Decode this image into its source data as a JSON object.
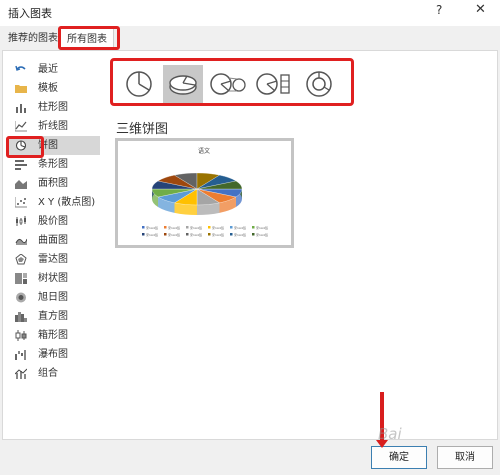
{
  "dialog": {
    "title": "插入图表",
    "help": "?",
    "close": "✕"
  },
  "tabs": [
    {
      "label": "推荐的图表"
    },
    {
      "label": "所有图表"
    }
  ],
  "sidebar": {
    "items": [
      {
        "label": "最近",
        "icon": "undo-arrow-icon"
      },
      {
        "label": "模板",
        "icon": "folder-icon"
      },
      {
        "label": "柱形图",
        "icon": "column-chart-icon"
      },
      {
        "label": "折线图",
        "icon": "line-chart-icon"
      },
      {
        "label": "饼图",
        "icon": "pie-chart-icon",
        "selected": true
      },
      {
        "label": "条形图",
        "icon": "bar-chart-icon"
      },
      {
        "label": "面积图",
        "icon": "area-chart-icon"
      },
      {
        "label": "X Y (散点图)",
        "icon": "scatter-chart-icon"
      },
      {
        "label": "股价图",
        "icon": "stock-chart-icon"
      },
      {
        "label": "曲面图",
        "icon": "surface-chart-icon"
      },
      {
        "label": "雷达图",
        "icon": "radar-chart-icon"
      },
      {
        "label": "树状图",
        "icon": "treemap-chart-icon"
      },
      {
        "label": "旭日图",
        "icon": "sunburst-chart-icon"
      },
      {
        "label": "直方图",
        "icon": "histogram-chart-icon"
      },
      {
        "label": "箱形图",
        "icon": "box-whisker-chart-icon"
      },
      {
        "label": "瀑布图",
        "icon": "waterfall-chart-icon"
      },
      {
        "label": "组合",
        "icon": "combo-chart-icon"
      }
    ]
  },
  "subtypes": [
    {
      "icon": "pie-icon"
    },
    {
      "icon": "3d-pie-icon",
      "selected": true
    },
    {
      "icon": "pie-of-pie-icon"
    },
    {
      "icon": "bar-of-pie-icon"
    },
    {
      "icon": "doughnut-icon"
    }
  ],
  "section_title": "三维饼图",
  "preview": {
    "chart_title": "语文",
    "legend_items": [
      "宋1A4班",
      "宋1A4班",
      "宋1A4班",
      "宋1A4班",
      "宋1A4班",
      "宋1A4班",
      "宋1A4班",
      "宋1A4班",
      "宋1A4班",
      "宋1A4班",
      "宋1A4班",
      "宋1A4班"
    ],
    "slice_colors": [
      "#4472c4",
      "#ed7d31",
      "#a5a5a5",
      "#ffc000",
      "#5b9bd5",
      "#70ad47",
      "#264478",
      "#9e480e",
      "#636363",
      "#997300",
      "#255e91",
      "#43682b"
    ]
  },
  "buttons": {
    "ok": "确定",
    "cancel": "取消"
  },
  "watermark": "Bai"
}
